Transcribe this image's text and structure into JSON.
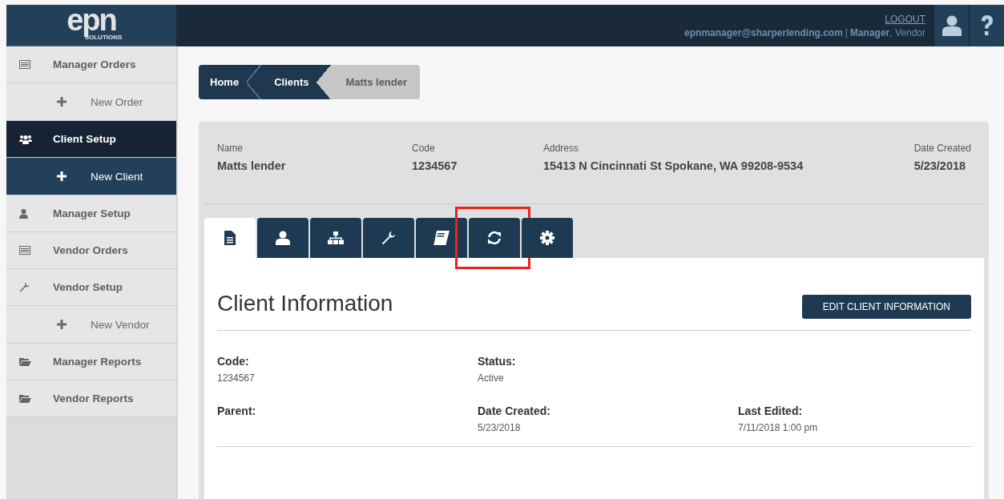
{
  "logo": {
    "mark": "epn",
    "sub": "SOLUTIONS"
  },
  "header": {
    "logout": "LOGOUT",
    "email": "epnmanager@sharperlending.com",
    "separator": "|",
    "role": "Manager",
    "role_rest": ", Vendor"
  },
  "sidebar": {
    "items": [
      {
        "label": "Manager Orders",
        "selected": false,
        "children": [
          {
            "label": "New Order",
            "selected": false
          }
        ]
      },
      {
        "label": "Client Setup",
        "selected": true,
        "children": [
          {
            "label": "New Client",
            "selected": false
          }
        ]
      },
      {
        "label": "Manager Setup",
        "selected": false
      },
      {
        "label": "Vendor Orders",
        "selected": false
      },
      {
        "label": "Vendor Setup",
        "selected": false,
        "children": [
          {
            "label": "New Vendor",
            "selected": false
          }
        ]
      },
      {
        "label": "Manager Reports",
        "selected": false
      },
      {
        "label": "Vendor Reports",
        "selected": false
      }
    ]
  },
  "breadcrumb": [
    "Home",
    "Clients",
    "Matts lender"
  ],
  "summary": [
    {
      "label": "Name",
      "value": "Matts lender"
    },
    {
      "label": "Code",
      "value": "1234567"
    },
    {
      "label": "Address",
      "value": "15413 N Cincinnati St Spokane, WA 99208-9534"
    },
    {
      "label": "Date Created",
      "value": "5/23/2018"
    }
  ],
  "tabs": [
    {
      "selected": true,
      "highlighted": false
    },
    {
      "selected": false,
      "highlighted": false
    },
    {
      "selected": false,
      "highlighted": false
    },
    {
      "selected": false,
      "highlighted": false
    },
    {
      "selected": false,
      "highlighted": false
    },
    {
      "selected": false,
      "highlighted": true
    },
    {
      "selected": false,
      "highlighted": false
    }
  ],
  "content": {
    "title": "Client Information",
    "edit_button": "EDIT CLIENT INFORMATION",
    "field_rows": [
      [
        {
          "label": "Code:",
          "value": "1234567"
        },
        {
          "label": "Status:",
          "value": "Active"
        }
      ],
      [
        {
          "label": "Parent:"
        },
        {
          "label": "Date Created:",
          "value": "5/23/2018"
        },
        {
          "label": "Last Edited:",
          "value": "7/11/2018 1:00 pm"
        }
      ]
    ]
  }
}
